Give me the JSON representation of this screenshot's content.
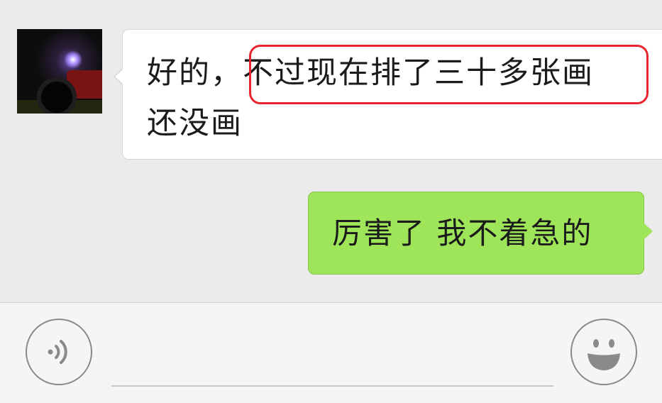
{
  "messages": {
    "incoming": {
      "line1_prefix": "好的，",
      "line1_highlighted": "不过现在排了三十多张画",
      "line2": "还没画"
    },
    "outgoing": {
      "text": "厉害了  我不着急的"
    }
  },
  "input_bar": {
    "text_value": "",
    "voice_icon": "voice-icon",
    "emoji_icon": "emoji-icon"
  },
  "colors": {
    "chat_background": "#ebebeb",
    "incoming_bubble": "#ffffff",
    "outgoing_bubble": "#9fe55a",
    "highlight_border": "#e8252e"
  }
}
